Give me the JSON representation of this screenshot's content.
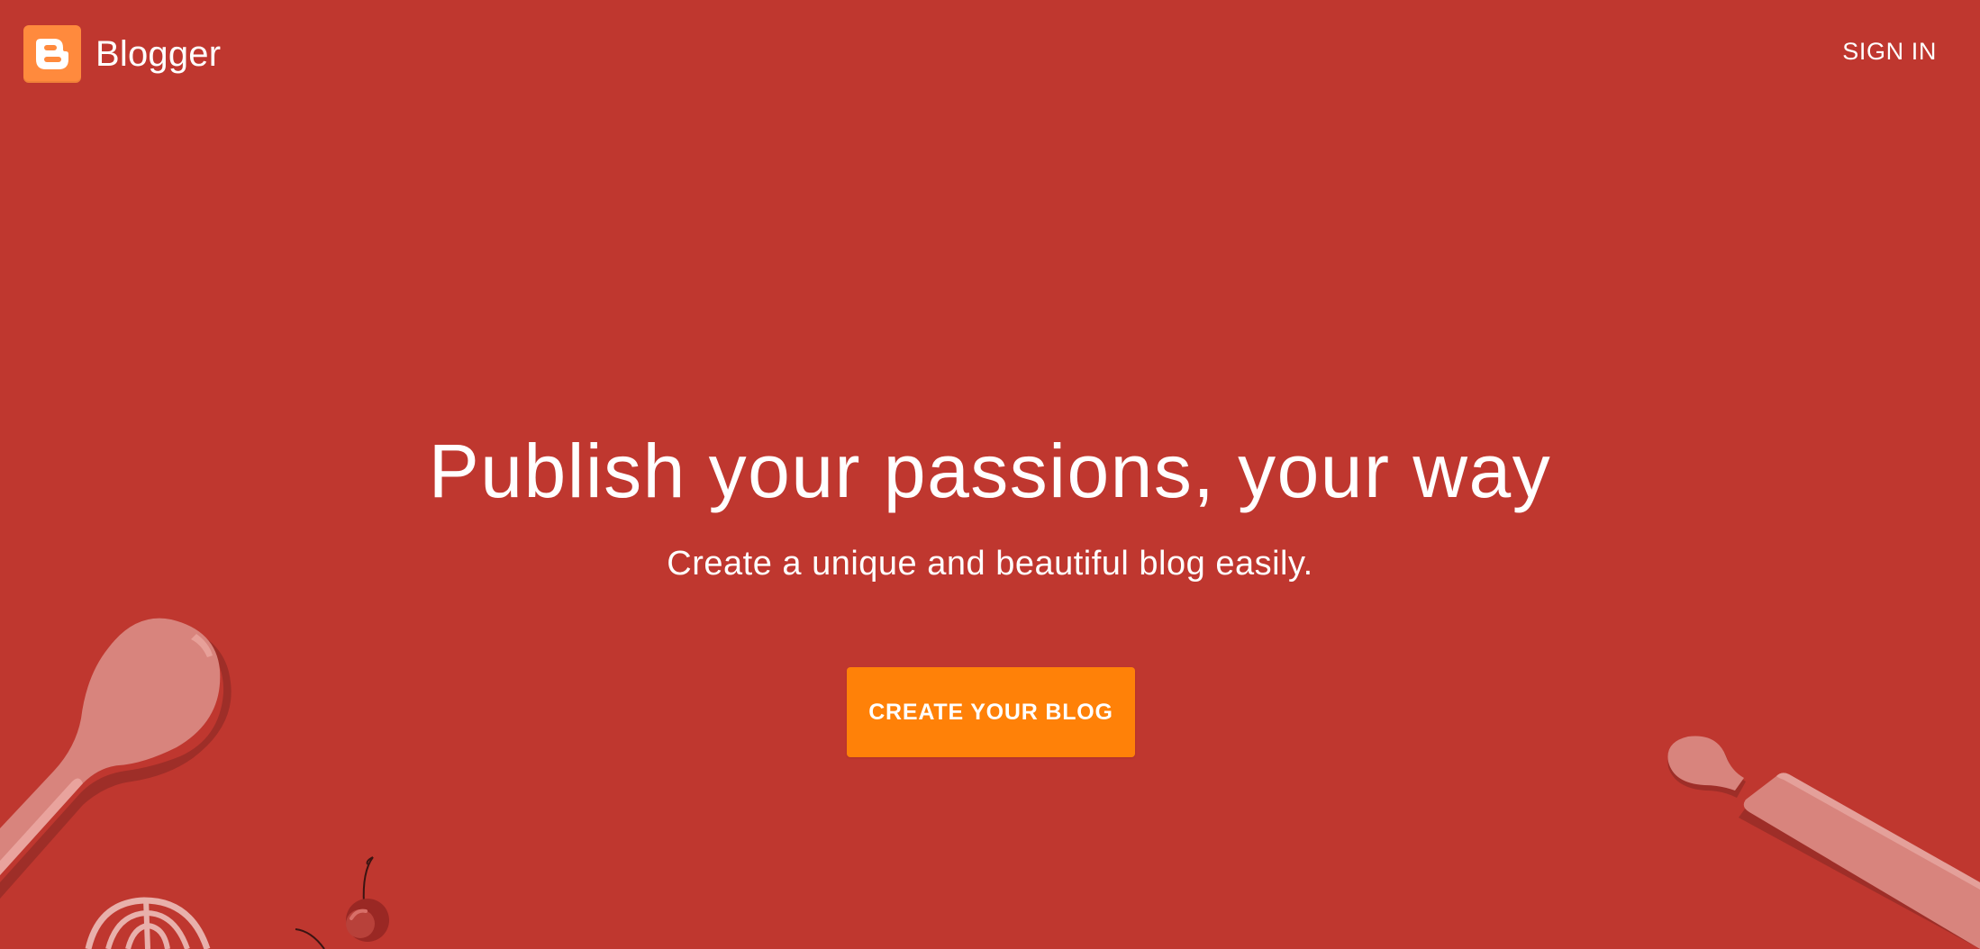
{
  "header": {
    "brand_name": "Blogger",
    "sign_in_label": "SIGN IN"
  },
  "hero": {
    "title": "Publish your passions, your way",
    "subtitle": "Create a unique and beautiful blog easily.",
    "cta_label": "CREATE YOUR BLOG"
  },
  "colors": {
    "background": "#bf372f",
    "brand_orange": "#ff8a3d",
    "cta_orange": "#ff8108",
    "illustration_pink": "#d8847d"
  },
  "icons": {
    "logo": "blogger-logo-icon",
    "spoon": "wooden-spoon-illustration",
    "whisk": "whisk-illustration",
    "cherry": "cherry-illustration",
    "rolling_pin": "rolling-pin-illustration"
  }
}
